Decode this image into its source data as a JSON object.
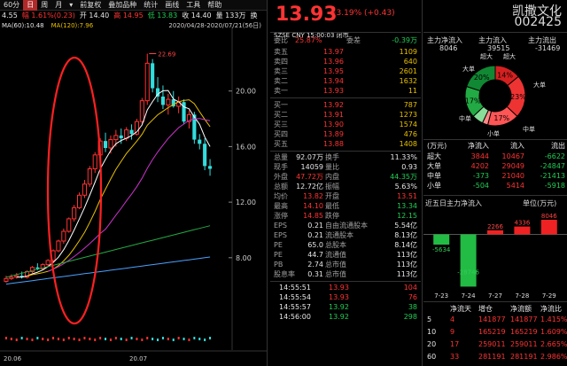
{
  "chart": {
    "toolbar": [
      {
        "label": "60分",
        "active": false
      },
      {
        "label": "日",
        "active": true
      },
      {
        "label": "周",
        "active": false
      },
      {
        "label": "月",
        "active": false
      },
      {
        "label": "▾",
        "active": false
      },
      {
        "label": "前复权",
        "active": false
      },
      {
        "label": "叠加品种",
        "active": false
      },
      {
        "label": "统计",
        "active": false
      },
      {
        "label": "画线",
        "active": false
      },
      {
        "label": "工具",
        "active": false
      },
      {
        "label": "帮助",
        "active": false
      }
    ],
    "quote": [
      "4.55",
      "幅 1.61%(0.23)",
      "开 14.40",
      "高 14.95",
      "低 13.83",
      "收 14.40",
      "量 133万",
      "换"
    ],
    "ma": [
      {
        "text": "MA(60):10.48",
        "color": "#e6e6e6"
      },
      {
        "text": "MA(120):7.96",
        "color": "#e8c000"
      }
    ],
    "date_range": "2020/04/28-2020/07/21(56日)",
    "y_ticks": [
      "20.00",
      "16.00",
      "12.00",
      "8.00"
    ],
    "x_ticks": [
      "20.06",
      "20.07"
    ],
    "high_label": "22.69",
    "candles": [
      [
        6.3,
        6.7,
        6.2,
        6.5
      ],
      [
        6.5,
        6.8,
        6.4,
        6.6
      ],
      [
        6.6,
        6.9,
        6.5,
        6.7
      ],
      [
        6.7,
        7.0,
        6.5,
        6.6
      ],
      [
        6.6,
        7.1,
        6.5,
        7.0
      ],
      [
        7.0,
        7.4,
        6.9,
        7.3
      ],
      [
        7.3,
        7.6,
        7.1,
        7.2
      ],
      [
        7.2,
        7.6,
        7.1,
        7.5
      ],
      [
        7.5,
        7.9,
        7.4,
        7.8
      ],
      [
        7.8,
        8.6,
        7.7,
        8.5
      ],
      [
        8.5,
        9.3,
        8.4,
        9.2
      ],
      [
        9.2,
        10.1,
        9.0,
        9.9
      ],
      [
        9.9,
        10.9,
        9.8,
        10.8
      ],
      [
        10.8,
        11.8,
        10.6,
        11.6
      ],
      [
        11.6,
        12.7,
        11.5,
        12.5
      ],
      [
        12.5,
        13.6,
        12.3,
        13.3
      ],
      [
        13.3,
        14.6,
        13.1,
        14.4
      ],
      [
        14.4,
        15.6,
        14.1,
        15.4
      ],
      [
        15.4,
        16.6,
        15.2,
        16.4
      ],
      [
        16.4,
        17.0,
        15.6,
        15.9
      ],
      [
        15.9,
        16.8,
        15.5,
        16.5
      ],
      [
        16.5,
        17.2,
        16.0,
        16.8
      ],
      [
        16.8,
        17.3,
        16.2,
        16.6
      ],
      [
        16.6,
        17.4,
        16.4,
        17.2
      ],
      [
        17.2,
        17.6,
        16.5,
        16.9
      ],
      [
        16.9,
        18.0,
        16.8,
        17.8
      ],
      [
        17.8,
        19.5,
        17.6,
        19.3
      ],
      [
        19.3,
        22.69,
        19.0,
        22.0
      ],
      [
        22.0,
        22.3,
        19.9,
        20.2
      ],
      [
        20.2,
        21.0,
        19.2,
        19.6
      ],
      [
        19.6,
        20.4,
        18.7,
        19.0
      ],
      [
        19.0,
        19.8,
        18.3,
        19.4
      ],
      [
        19.4,
        20.0,
        18.8,
        18.9
      ],
      [
        18.9,
        19.6,
        18.4,
        19.2
      ],
      [
        19.2,
        19.4,
        17.6,
        17.8
      ],
      [
        17.8,
        18.6,
        17.3,
        18.3
      ],
      [
        18.3,
        18.5,
        16.2,
        16.5
      ],
      [
        16.5,
        16.9,
        15.8,
        16.2
      ],
      [
        16.2,
        16.6,
        14.3,
        14.6
      ],
      [
        14.6,
        15.1,
        13.9,
        14.4
      ]
    ],
    "annotation": "red-ellipse-highlight"
  },
  "quote": {
    "price": "13.93",
    "change": "+3.19% (+0.43)",
    "exchange": "SZSE  CNY  15:00:03  闭市",
    "weibi": {
      "label": "委比",
      "value": "25.87%",
      "label2": "委差",
      "value2": "-0.39万"
    },
    "asks": [
      {
        "label": "卖五",
        "price": "13.97",
        "vol": "1109"
      },
      {
        "label": "卖四",
        "price": "13.96",
        "vol": "640"
      },
      {
        "label": "卖三",
        "price": "13.95",
        "vol": "2601"
      },
      {
        "label": "卖二",
        "price": "13.94",
        "vol": "1632"
      },
      {
        "label": "卖一",
        "price": "13.93",
        "vol": "11"
      }
    ],
    "bids": [
      {
        "label": "买一",
        "price": "13.92",
        "vol": "787"
      },
      {
        "label": "买二",
        "price": "13.91",
        "vol": "1273"
      },
      {
        "label": "买三",
        "price": "13.90",
        "vol": "1574"
      },
      {
        "label": "买四",
        "price": "13.89",
        "vol": "476"
      },
      {
        "label": "买五",
        "price": "13.88",
        "vol": "1408"
      }
    ],
    "stats": [
      {
        "l": "总量",
        "v": "92.07万",
        "l2": "换手",
        "v2": "11.33%",
        "c": "white",
        "c2": "white"
      },
      {
        "l": "现手",
        "v": "14059",
        "l2": "量比",
        "v2": "0.93",
        "c": "white",
        "c2": "white"
      },
      {
        "l": "外盘",
        "v": "47.72万",
        "l2": "内盘",
        "v2": "44.35万",
        "c": "up",
        "c2": "down"
      },
      {
        "l": "总额",
        "v": "12.72亿",
        "l2": "振幅",
        "v2": "5.63%",
        "c": "white",
        "c2": "white"
      },
      {
        "l": "均价",
        "v": "13.82",
        "l2": "开盘",
        "v2": "13.51",
        "c": "up",
        "c2": "up"
      },
      {
        "l": "最高",
        "v": "14.10",
        "l2": "最低",
        "v2": "13.34",
        "c": "up",
        "c2": "down"
      },
      {
        "l": "涨停",
        "v": "14.85",
        "l2": "跌停",
        "v2": "12.15",
        "c": "up",
        "c2": "down"
      },
      {
        "l": "EPS",
        "v": "0.21",
        "l2": "自由流通股本",
        "v2": "5.54亿",
        "c": "white",
        "c2": "white",
        "sup": "TTM"
      },
      {
        "l": "EPS",
        "v": "0.21",
        "l2": "流通股本",
        "v2": "8.13亿",
        "c": "white",
        "c2": "white",
        "sup": "2020Ⅰ"
      },
      {
        "l": "PE",
        "v": "65.0",
        "l2": "总股本",
        "v2": "8.14亿",
        "c": "white",
        "c2": "white",
        "sup": "TTM"
      },
      {
        "l": "PE",
        "v": "44.7",
        "l2": "流通值",
        "v2": "113亿",
        "c": "white",
        "c2": "white",
        "sup": "2020Ⅰ"
      },
      {
        "l": "PB",
        "v": "2.74",
        "l2": "总市值",
        "v2": "113亿",
        "c": "white",
        "c2": "white",
        "sup": "LF"
      },
      {
        "l": "股息率",
        "v": "0.31",
        "l2": "总市值",
        "v2": "113亿",
        "c": "white",
        "c2": "white",
        "sup": "TTM"
      }
    ],
    "ticks": [
      {
        "t": "14:55:51",
        "p": "13.93",
        "v": "104",
        "c": "up"
      },
      {
        "t": "14:55:54",
        "p": "13.93",
        "v": "76",
        "c": "up"
      },
      {
        "t": "14:55:57",
        "p": "13.92",
        "v": "38",
        "c": "down"
      },
      {
        "t": "14:56:00",
        "p": "13.92",
        "v": "298",
        "c": "down"
      }
    ]
  },
  "right": {
    "name": "凯撒文化",
    "code": "002425",
    "flow_header": {
      "net_label": "主力净流入",
      "in_label": "主力流入",
      "out_label": "主力流出"
    },
    "flow_values": {
      "net": "8046",
      "in": "39515",
      "out": "-31469"
    },
    "pie": {
      "labels_in": [
        "超大",
        "大单",
        "中单",
        "小单"
      ],
      "labels_out": [
        "超大",
        "大单",
        "中单",
        "小单"
      ],
      "slices": [
        {
          "name": "超大流入",
          "pct": 14,
          "color": "#d62020",
          "label": "14%"
        },
        {
          "name": "大单流入",
          "pct": 23,
          "color": "#ee3333",
          "label": "23%"
        },
        {
          "name": "中单流入",
          "pct": 17,
          "color": "#ff5555",
          "label": "17%"
        },
        {
          "name": "小单流入",
          "pct": 3,
          "color": "#ff8888",
          "label": ""
        },
        {
          "name": "小单流出",
          "pct": 6,
          "color": "#88dd99",
          "label": ""
        },
        {
          "name": "中单流出",
          "pct": 17,
          "color": "#22aa44",
          "label": "17%"
        },
        {
          "name": "大单流出",
          "pct": 20,
          "color": "#118833",
          "label": "20%"
        }
      ],
      "center": "",
      "big_label": "大单",
      "mid_label": "中单",
      "small_label": "小单"
    },
    "table_header": [
      "(万元)",
      "净流入",
      "流入",
      "流出"
    ],
    "table_rows": [
      {
        "name": "超大",
        "net": "3844",
        "in": "10467",
        "out": "-6622",
        "nc": "up"
      },
      {
        "name": "大单",
        "net": "4202",
        "in": "29049",
        "out": "-24847",
        "nc": "up"
      },
      {
        "name": "中单",
        "net": "-373",
        "in": "21040",
        "out": "-21413",
        "nc": "down"
      },
      {
        "name": "小单",
        "net": "-504",
        "in": "5414",
        "out": "-5918",
        "nc": "down"
      }
    ],
    "recent_title": "近五日主力净流入",
    "recent_unit": "单位(万元)",
    "chart_data": {
      "type": "bar",
      "categories": [
        "7-23",
        "7-24",
        "7-27",
        "7-28",
        "7-29"
      ],
      "values": [
        -5634,
        -28746,
        2266,
        4336,
        8046
      ],
      "ylim": [
        -30000,
        10000
      ]
    },
    "bottom_header": [
      "",
      "净流天",
      "增仓",
      "净流额",
      "净流比"
    ],
    "bottom_rows": [
      {
        "d": "5",
        "days": "4",
        "zc": "141877",
        "amt": "141877",
        "ratio": "1.415%"
      },
      {
        "d": "10",
        "days": "9",
        "zc": "165219",
        "amt": "165219",
        "ratio": "1.609%"
      },
      {
        "d": "20",
        "days": "17",
        "zc": "259011",
        "amt": "259011",
        "ratio": "2.665%"
      },
      {
        "d": "60",
        "days": "33",
        "zc": "281191",
        "amt": "281191",
        "ratio": "2.986%"
      }
    ]
  }
}
